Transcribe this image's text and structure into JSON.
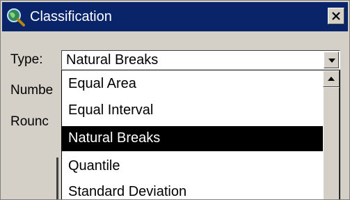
{
  "window": {
    "title": "Classification"
  },
  "form": {
    "type_label": "Type:",
    "type_value": "Natural Breaks",
    "number_label": "Numbe",
    "round_label": "Rounc"
  },
  "dropdown": {
    "options": [
      "Equal Area",
      "Equal Interval",
      "Natural Breaks",
      "Quantile",
      "Standard Deviation"
    ],
    "selected": "Natural Breaks"
  },
  "icons": {
    "title": "globe-magnifier-icon",
    "close": "close-icon",
    "combo_arrow": "chevron-down-icon",
    "scroll_up": "scroll-up-arrow-icon"
  },
  "colors": {
    "titlebar": "#0a246a",
    "face": "#d4d0c8",
    "selection": "#000000"
  }
}
